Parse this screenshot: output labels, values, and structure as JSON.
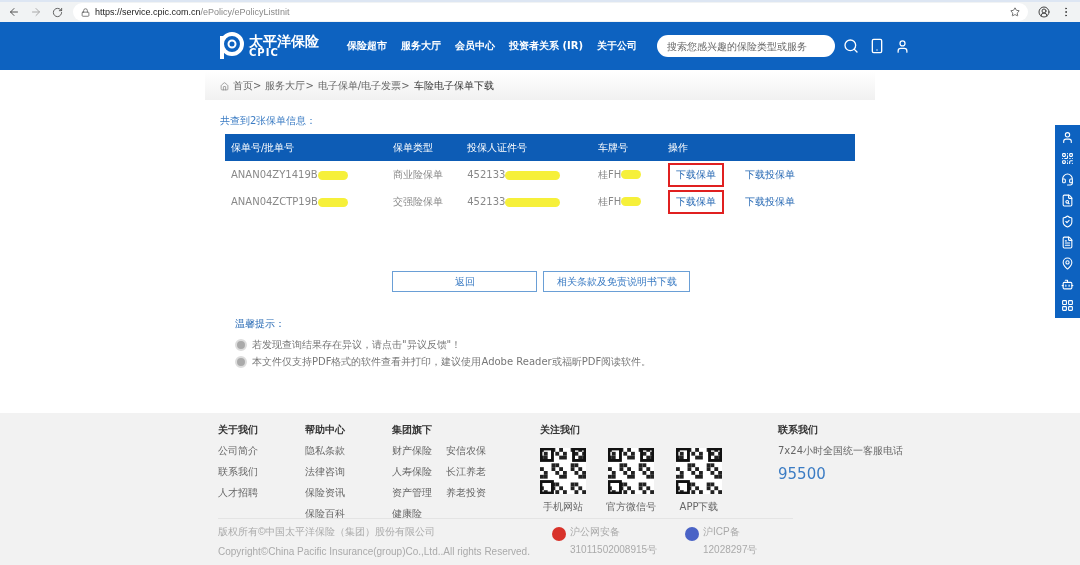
{
  "browser": {
    "url_host": "https://service.cpic.com.cn",
    "url_path": "/ePolicy/ePolicyListInit"
  },
  "header": {
    "logo_name": "太平洋保险",
    "logo_sub": "CPIC",
    "nav": [
      {
        "label": "保险超市"
      },
      {
        "label": "服务大厅"
      },
      {
        "label": "会员中心"
      },
      {
        "label": "投资者关系 (IR)"
      },
      {
        "label": "关于公司"
      }
    ],
    "search": {
      "placeholder": "搜索您感兴趣的保险类型或服务"
    }
  },
  "breadcrumb": [
    {
      "label": "首页>"
    },
    {
      "label": "服务大厅>"
    },
    {
      "label": "电子保单/电子发票>"
    },
    {
      "label": "车险电子保单下载"
    }
  ],
  "summary": "共查到2张保单信息：",
  "table": {
    "columns": [
      "保单号/批单号",
      "保单类型",
      "投保人证件号",
      "车牌号",
      "操作"
    ],
    "rows": [
      {
        "policy_no": "ANAN04ZY1419B",
        "type": "商业险保单",
        "holder_id": "452133",
        "plate": "桂FH",
        "download": "下载保单",
        "download_app": "下载投保单",
        "highlighted": true
      },
      {
        "policy_no": "ANAN04ZCTP19B",
        "type": "交强险保单",
        "holder_id": "452133",
        "plate": "桂FH",
        "download": "下载保单",
        "download_app": "下载投保单",
        "highlighted": true
      }
    ]
  },
  "buttons": [
    {
      "label": "返回"
    },
    {
      "label": "相关条款及免责说明书下载"
    }
  ],
  "tips": {
    "title": "温馨提示：",
    "items": [
      "若发现查询结果存在异议，请点击\"异议反馈\"！",
      "本文件仅支持PDF格式的软件查看并打印，建议使用Adobe Reader或福昕PDF阅读软件。"
    ]
  },
  "footer": {
    "columns": [
      {
        "title": "关于我们",
        "links": [
          [
            "公司简介",
            "联系我们",
            "人才招聘"
          ]
        ]
      },
      {
        "title": "帮助中心",
        "links": [
          [
            "隐私条款",
            "法律咨询",
            "保险资讯",
            "保险百科"
          ]
        ]
      },
      {
        "title": "集团旗下",
        "links": [
          [
            "财产保险",
            "人寿保险",
            "资产管理",
            "健康险"
          ],
          [
            "安信农保",
            "长江养老",
            "养老投资"
          ]
        ]
      }
    ],
    "follow": {
      "title": "关注我们",
      "codes": [
        "手机网站",
        "官方微信号",
        "APP下载"
      ]
    },
    "contact": {
      "title": "联系我们",
      "note": "7x24小时全国统一客服电话",
      "phone": "95500"
    },
    "copyright": [
      "版权所有©中国太平洋保险（集团）股份有限公司",
      "Copyright©China Pacific Insurance(group)Co.,Ltd..All rights Reserved."
    ],
    "records": [
      {
        "kind": "police",
        "label": "沪公网安备",
        "number": "31011502008915号"
      },
      {
        "kind": "icp",
        "label": "沪ICP备",
        "number": "12028297号"
      }
    ]
  }
}
